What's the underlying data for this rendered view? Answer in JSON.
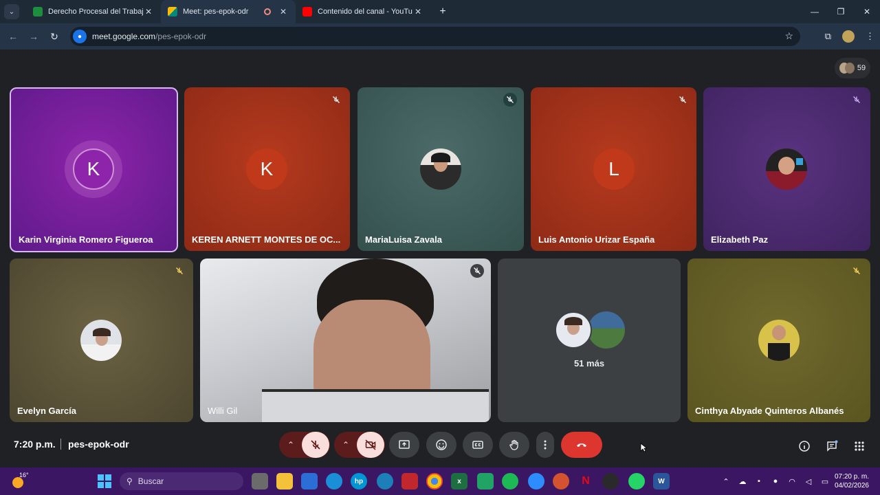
{
  "browser": {
    "tabs": [
      {
        "title": "Derecho Procesal del Trabajo I",
        "favicon_color": "#1e8e3e"
      },
      {
        "title": "Meet: pes-epok-odr",
        "favicon_color": "#00897b"
      },
      {
        "title": "Contenido del canal - YouTube",
        "favicon_color": "#ff0000"
      }
    ],
    "url_host": "meet.google.com",
    "url_path": "/pes-epok-odr"
  },
  "meet": {
    "participant_count": "59",
    "tiles": [
      {
        "name": "Karin Virginia Romero Figueroa",
        "letter": "K",
        "bg": "#6a1b9a"
      },
      {
        "name": "KEREN ARNETT MONTES DE OC...",
        "letter": "K",
        "bg": "#a8321c"
      },
      {
        "name": "MariaLuisa Zavala",
        "bg": "#3d5a58"
      },
      {
        "name": "Luis Antonio Urizar España",
        "letter": "L",
        "bg": "#a8321c"
      },
      {
        "name": "Elizabeth Paz",
        "bg": "#4a2a6e"
      },
      {
        "name": "Evelyn García",
        "bg": "#5c5436"
      },
      {
        "name": "Willi Gil"
      },
      {
        "more_label": "51 más"
      },
      {
        "name": "Cinthya Abyade Quinteros Albanés",
        "bg": "#6a6426"
      }
    ],
    "time": "7:20 p.m.",
    "meeting_code": "pes-epok-odr"
  },
  "taskbar": {
    "temperature": "16°",
    "search_placeholder": "Buscar",
    "clock_time": "07:20 p. m.",
    "clock_date": "04/02/2026"
  }
}
